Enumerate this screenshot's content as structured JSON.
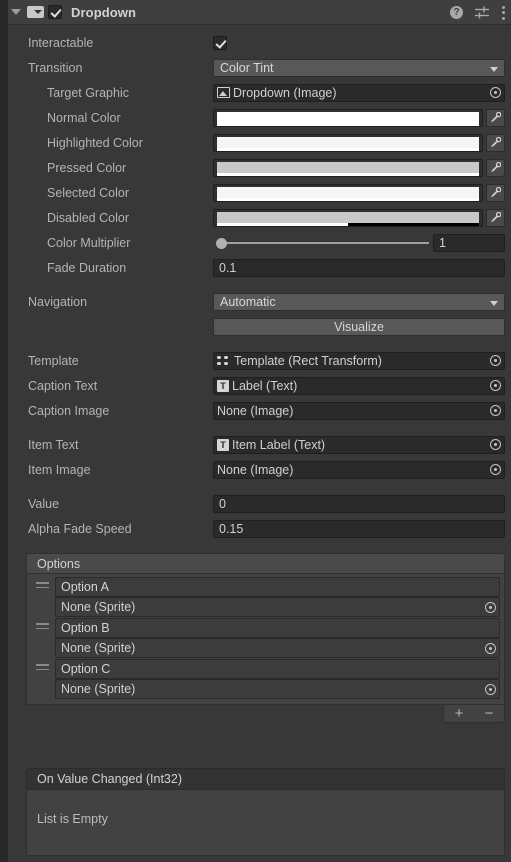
{
  "header": {
    "title": "Dropdown",
    "foldout_icon": "triangle-down-icon",
    "component_icon": "dropdown-component-icon",
    "enabled_checkbox": true,
    "help_icon": "?",
    "preset_icon": "preset-sliders-icon",
    "menu_icon": "three-dots-menu-icon"
  },
  "colors": {
    "panel_bg": "#383838",
    "header_bg": "#3f3f3f",
    "field_bg": "#2a2a2a",
    "popup_bg": "#585858",
    "list_bg": "#424242",
    "label": "#b4b4b4",
    "normal_color": "#FFFFFF",
    "highlighted_color": "#F5F5F5",
    "pressed_color": "#C8C8C8",
    "selected_color": "#F5F5F5",
    "disabled_color": "#C8C8C8"
  },
  "properties": {
    "interactable": {
      "label": "Interactable",
      "value": true
    },
    "transition": {
      "label": "Transition",
      "value": "Color Tint"
    },
    "target_graphic": {
      "label": "Target Graphic",
      "value": "Dropdown (Image)",
      "icon": "image-icon"
    },
    "normal_color": {
      "label": "Normal Color",
      "swatch": "#FFFFFF",
      "alpha": 100
    },
    "highlighted_color": {
      "label": "Highlighted Color",
      "swatch": "#F5F5F5",
      "alpha": 100
    },
    "pressed_color": {
      "label": "Pressed Color",
      "swatch": "#C8C8C8",
      "alpha": 100
    },
    "selected_color": {
      "label": "Selected Color",
      "swatch": "#F5F5F5",
      "alpha": 100
    },
    "disabled_color": {
      "label": "Disabled Color",
      "swatch": "#C8C8C8",
      "alpha": 50
    },
    "color_multiplier": {
      "label": "Color Multiplier",
      "value": "1",
      "slider_pct": 0
    },
    "fade_duration": {
      "label": "Fade Duration",
      "value": "0.1"
    },
    "navigation": {
      "label": "Navigation",
      "value": "Automatic"
    },
    "visualize": {
      "label": "Visualize"
    },
    "template": {
      "label": "Template",
      "value": "Template (Rect Transform)",
      "icon": "rect-transform-icon"
    },
    "caption_text": {
      "label": "Caption Text",
      "value": "Label (Text)",
      "icon": "text-icon"
    },
    "caption_image": {
      "label": "Caption Image",
      "value": "None (Image)",
      "icon": "none"
    },
    "item_text": {
      "label": "Item Text",
      "value": "Item Label (Text)",
      "icon": "text-icon"
    },
    "item_image": {
      "label": "Item Image",
      "value": "None (Image)",
      "icon": "none"
    },
    "value": {
      "label": "Value",
      "value": "0"
    },
    "alpha_fade_speed": {
      "label": "Alpha Fade Speed",
      "value": "0.15"
    }
  },
  "options_list": {
    "header": "Options",
    "items": [
      {
        "text": "Option A",
        "image": "None (Sprite)"
      },
      {
        "text": "Option B",
        "image": "None (Sprite)"
      },
      {
        "text": "Option C",
        "image": "None (Sprite)"
      }
    ],
    "add_label": "+",
    "remove_label": "−"
  },
  "event": {
    "header": "On Value Changed (Int32)",
    "empty_text": "List is Empty"
  }
}
